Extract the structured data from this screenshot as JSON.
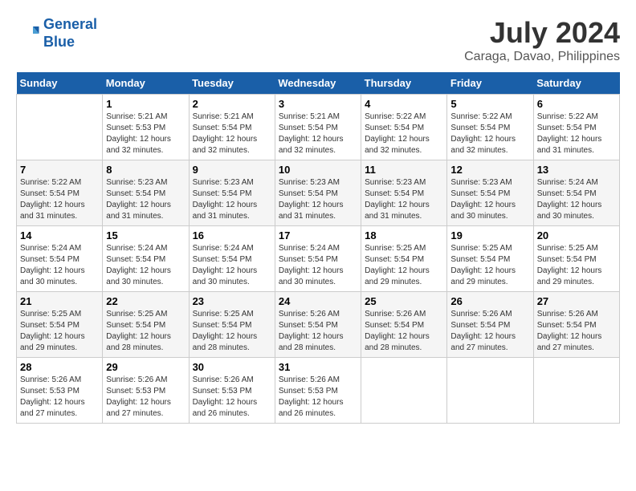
{
  "header": {
    "logo_line1": "General",
    "logo_line2": "Blue",
    "month_title": "July 2024",
    "subtitle": "Caraga, Davao, Philippines"
  },
  "days_of_week": [
    "Sunday",
    "Monday",
    "Tuesday",
    "Wednesday",
    "Thursday",
    "Friday",
    "Saturday"
  ],
  "weeks": [
    [
      {
        "day": "",
        "info": ""
      },
      {
        "day": "1",
        "info": "Sunrise: 5:21 AM\nSunset: 5:53 PM\nDaylight: 12 hours\nand 32 minutes."
      },
      {
        "day": "2",
        "info": "Sunrise: 5:21 AM\nSunset: 5:54 PM\nDaylight: 12 hours\nand 32 minutes."
      },
      {
        "day": "3",
        "info": "Sunrise: 5:21 AM\nSunset: 5:54 PM\nDaylight: 12 hours\nand 32 minutes."
      },
      {
        "day": "4",
        "info": "Sunrise: 5:22 AM\nSunset: 5:54 PM\nDaylight: 12 hours\nand 32 minutes."
      },
      {
        "day": "5",
        "info": "Sunrise: 5:22 AM\nSunset: 5:54 PM\nDaylight: 12 hours\nand 32 minutes."
      },
      {
        "day": "6",
        "info": "Sunrise: 5:22 AM\nSunset: 5:54 PM\nDaylight: 12 hours\nand 31 minutes."
      }
    ],
    [
      {
        "day": "7",
        "info": "Sunrise: 5:22 AM\nSunset: 5:54 PM\nDaylight: 12 hours\nand 31 minutes."
      },
      {
        "day": "8",
        "info": "Sunrise: 5:23 AM\nSunset: 5:54 PM\nDaylight: 12 hours\nand 31 minutes."
      },
      {
        "day": "9",
        "info": "Sunrise: 5:23 AM\nSunset: 5:54 PM\nDaylight: 12 hours\nand 31 minutes."
      },
      {
        "day": "10",
        "info": "Sunrise: 5:23 AM\nSunset: 5:54 PM\nDaylight: 12 hours\nand 31 minutes."
      },
      {
        "day": "11",
        "info": "Sunrise: 5:23 AM\nSunset: 5:54 PM\nDaylight: 12 hours\nand 31 minutes."
      },
      {
        "day": "12",
        "info": "Sunrise: 5:23 AM\nSunset: 5:54 PM\nDaylight: 12 hours\nand 30 minutes."
      },
      {
        "day": "13",
        "info": "Sunrise: 5:24 AM\nSunset: 5:54 PM\nDaylight: 12 hours\nand 30 minutes."
      }
    ],
    [
      {
        "day": "14",
        "info": "Sunrise: 5:24 AM\nSunset: 5:54 PM\nDaylight: 12 hours\nand 30 minutes."
      },
      {
        "day": "15",
        "info": "Sunrise: 5:24 AM\nSunset: 5:54 PM\nDaylight: 12 hours\nand 30 minutes."
      },
      {
        "day": "16",
        "info": "Sunrise: 5:24 AM\nSunset: 5:54 PM\nDaylight: 12 hours\nand 30 minutes."
      },
      {
        "day": "17",
        "info": "Sunrise: 5:24 AM\nSunset: 5:54 PM\nDaylight: 12 hours\nand 30 minutes."
      },
      {
        "day": "18",
        "info": "Sunrise: 5:25 AM\nSunset: 5:54 PM\nDaylight: 12 hours\nand 29 minutes."
      },
      {
        "day": "19",
        "info": "Sunrise: 5:25 AM\nSunset: 5:54 PM\nDaylight: 12 hours\nand 29 minutes."
      },
      {
        "day": "20",
        "info": "Sunrise: 5:25 AM\nSunset: 5:54 PM\nDaylight: 12 hours\nand 29 minutes."
      }
    ],
    [
      {
        "day": "21",
        "info": "Sunrise: 5:25 AM\nSunset: 5:54 PM\nDaylight: 12 hours\nand 29 minutes."
      },
      {
        "day": "22",
        "info": "Sunrise: 5:25 AM\nSunset: 5:54 PM\nDaylight: 12 hours\nand 28 minutes."
      },
      {
        "day": "23",
        "info": "Sunrise: 5:25 AM\nSunset: 5:54 PM\nDaylight: 12 hours\nand 28 minutes."
      },
      {
        "day": "24",
        "info": "Sunrise: 5:26 AM\nSunset: 5:54 PM\nDaylight: 12 hours\nand 28 minutes."
      },
      {
        "day": "25",
        "info": "Sunrise: 5:26 AM\nSunset: 5:54 PM\nDaylight: 12 hours\nand 28 minutes."
      },
      {
        "day": "26",
        "info": "Sunrise: 5:26 AM\nSunset: 5:54 PM\nDaylight: 12 hours\nand 27 minutes."
      },
      {
        "day": "27",
        "info": "Sunrise: 5:26 AM\nSunset: 5:54 PM\nDaylight: 12 hours\nand 27 minutes."
      }
    ],
    [
      {
        "day": "28",
        "info": "Sunrise: 5:26 AM\nSunset: 5:53 PM\nDaylight: 12 hours\nand 27 minutes."
      },
      {
        "day": "29",
        "info": "Sunrise: 5:26 AM\nSunset: 5:53 PM\nDaylight: 12 hours\nand 27 minutes."
      },
      {
        "day": "30",
        "info": "Sunrise: 5:26 AM\nSunset: 5:53 PM\nDaylight: 12 hours\nand 26 minutes."
      },
      {
        "day": "31",
        "info": "Sunrise: 5:26 AM\nSunset: 5:53 PM\nDaylight: 12 hours\nand 26 minutes."
      },
      {
        "day": "",
        "info": ""
      },
      {
        "day": "",
        "info": ""
      },
      {
        "day": "",
        "info": ""
      }
    ]
  ]
}
